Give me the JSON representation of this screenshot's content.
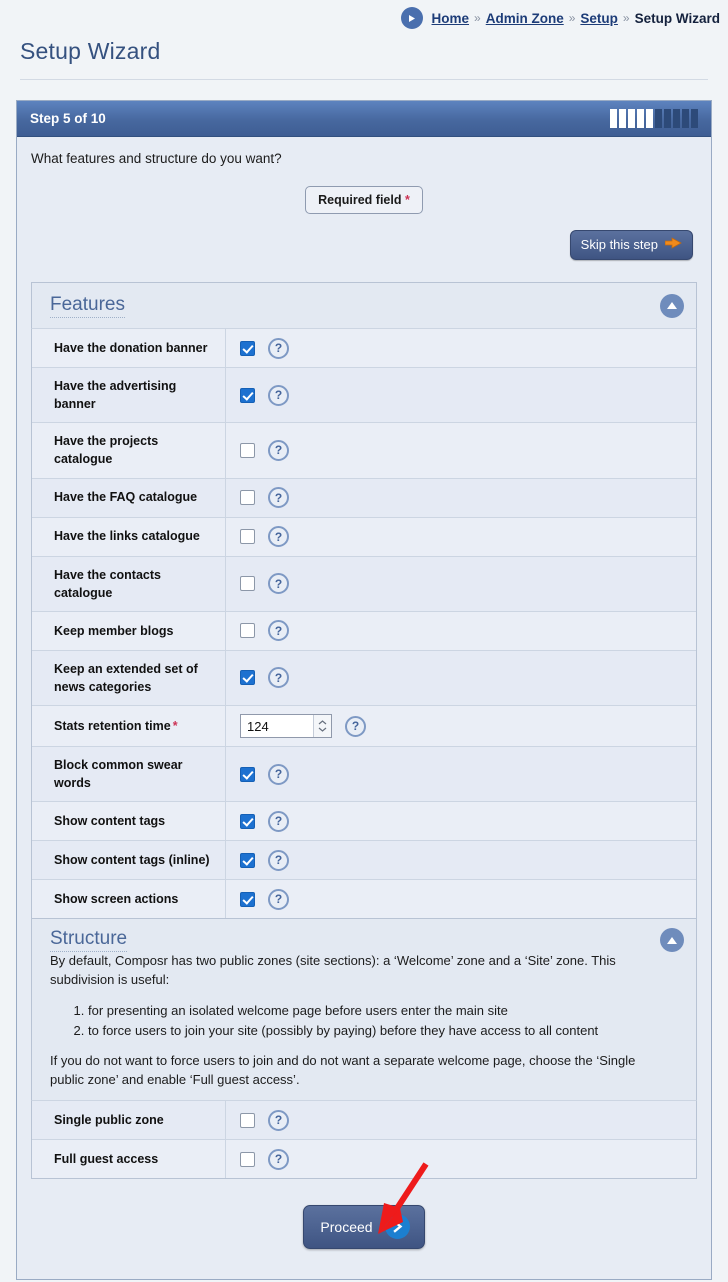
{
  "breadcrumb": {
    "play_icon": "play-circle-icon",
    "items": [
      {
        "label": "Home",
        "current": false
      },
      {
        "label": "Admin Zone",
        "current": false
      },
      {
        "label": "Setup",
        "current": false
      },
      {
        "label": "Setup Wizard",
        "current": true
      }
    ],
    "separator": "»"
  },
  "page": {
    "title": "Setup Wizard"
  },
  "wizard": {
    "step_label": "Step 5 of 10",
    "step_current": 5,
    "step_total": 10,
    "question": "What features and structure do you want?",
    "required_field_label": "Required field",
    "required_field_star": "*",
    "skip_label": "Skip this step",
    "skip_icon": "arrow-right-orange-icon",
    "proceed_label": "Proceed",
    "proceed_icon": "chevron-right-icon",
    "header_accent": "#47689f",
    "progress_on_color": "#ffffff",
    "progress_off_color": "#2d4a79"
  },
  "features_section": {
    "title": "Features",
    "collapse_icon": "triangle-up-icon",
    "help_icon": "question-mark-icon",
    "rows": [
      {
        "label": "Have the donation banner",
        "type": "checkbox",
        "checked": true
      },
      {
        "label": "Have the advertising banner",
        "type": "checkbox",
        "checked": true
      },
      {
        "label": "Have the projects catalogue",
        "type": "checkbox",
        "checked": false
      },
      {
        "label": "Have the FAQ catalogue",
        "type": "checkbox",
        "checked": false
      },
      {
        "label": "Have the links catalogue",
        "type": "checkbox",
        "checked": false
      },
      {
        "label": "Have the contacts catalogue",
        "type": "checkbox",
        "checked": false
      },
      {
        "label": "Keep member blogs",
        "type": "checkbox",
        "checked": false
      },
      {
        "label": "Keep an extended set of news categories",
        "type": "checkbox",
        "checked": true
      },
      {
        "label": "Stats retention time",
        "type": "number",
        "value": "124",
        "required": true,
        "required_mark": "*"
      },
      {
        "label": "Block common swear words",
        "type": "checkbox",
        "checked": true
      },
      {
        "label": "Show content tags",
        "type": "checkbox",
        "checked": true
      },
      {
        "label": "Show content tags (inline)",
        "type": "checkbox",
        "checked": true
      },
      {
        "label": "Show screen actions",
        "type": "checkbox",
        "checked": true
      }
    ]
  },
  "structure_section": {
    "title": "Structure",
    "collapse_icon": "triangle-up-icon",
    "paragraph1": "By default, Composr has two public zones (site sections): a ‘Welcome’ zone and a ‘Site’ zone. This subdivision is useful:",
    "list": [
      "for presenting an isolated welcome page before users enter the main site",
      "to force users to join your site (possibly by paying) before they have access to all content"
    ],
    "paragraph2": "If you do not want to force users to join and do not want a separate welcome page, choose the ‘Single public zone’ and enable ‘Full guest access’.",
    "rows": [
      {
        "label": "Single public zone",
        "type": "checkbox",
        "checked": false
      },
      {
        "label": "Full guest access",
        "type": "checkbox",
        "checked": false
      }
    ]
  },
  "annotation": {
    "arrow": "red-pointer-arrow",
    "color": "#ee1b1b"
  }
}
